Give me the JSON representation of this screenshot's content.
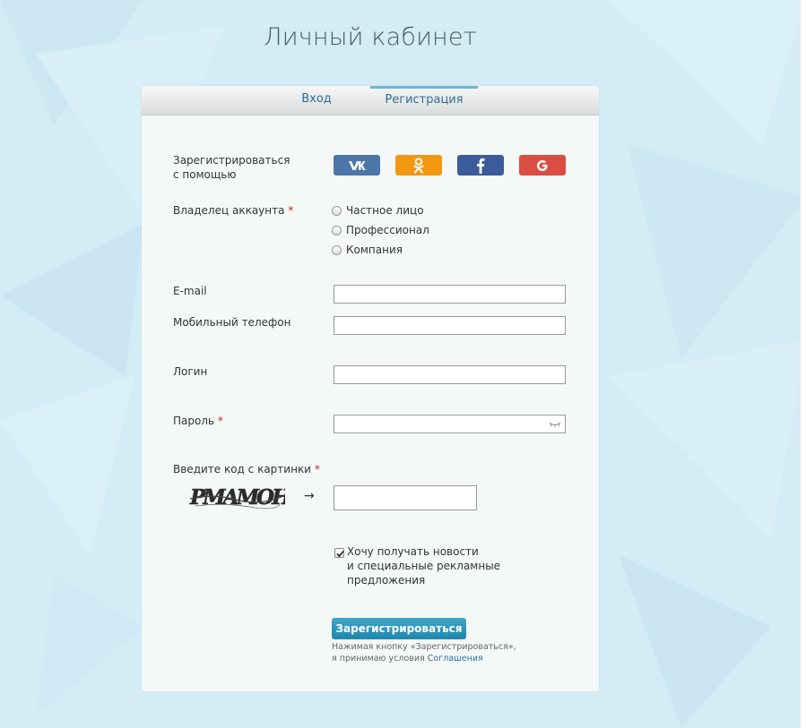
{
  "page": {
    "title": "Личный кабинет"
  },
  "tabs": [
    {
      "label": "Вход"
    },
    {
      "label": "Регистрация"
    }
  ],
  "social": {
    "label_line1": "Зарегистрироваться",
    "label_line2": "с помощью",
    "buttons": [
      {
        "name": "vk",
        "icon": "vk-icon",
        "color": "#4c76a8"
      },
      {
        "name": "odnoklassniki",
        "icon": "ok-icon",
        "color": "#f29711"
      },
      {
        "name": "facebook",
        "icon": "facebook-icon",
        "color": "#3b5b9a"
      },
      {
        "name": "google",
        "icon": "google-icon",
        "color": "#d94d42"
      }
    ]
  },
  "owner": {
    "label": "Владелец аккаунта",
    "required": "*",
    "options": [
      "Частное лицо",
      "Профессионал",
      "Компания"
    ]
  },
  "fields": {
    "email": {
      "label": "E-mail",
      "value": ""
    },
    "phone": {
      "label": "Мобильный телефон",
      "value": ""
    },
    "login": {
      "label": "Логин",
      "value": ""
    },
    "password": {
      "label": "Пароль",
      "required": "*",
      "value": ""
    }
  },
  "captcha": {
    "label": "Введите код с картинки",
    "required": "*",
    "code": "PMAMOH",
    "arrow": "→",
    "value": ""
  },
  "newsletter": {
    "checked": true,
    "line1": "Хочу получать новости",
    "line2": "и специальные рекламные",
    "line3": "предложения"
  },
  "submit": {
    "label": "Зарегистрироваться",
    "color": "#2596bd"
  },
  "terms": {
    "line1": "Нажимая кнопку «Зарегистрироваться»,",
    "line2_prefix": "я принимаю условия ",
    "link": "Соглашения"
  },
  "colors": {
    "background": "#d3ecf6",
    "card": "#f4f9f8",
    "link": "#2e6d97",
    "required": "#cc2222"
  }
}
